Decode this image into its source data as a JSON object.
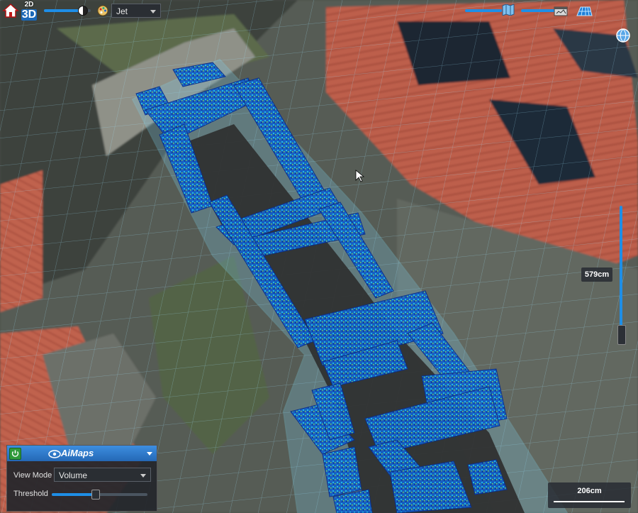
{
  "toolbar": {
    "mode_2d": "2D",
    "mode_3d": "3D",
    "palette": "Jet"
  },
  "viewport": {
    "height_readout": "579cm",
    "scale_label": "206cm"
  },
  "panel": {
    "brand": "AiMaps",
    "view_mode_label": "View Mode",
    "view_mode_value": "Volume",
    "threshold_label": "Threshold",
    "threshold_value": 0.45
  },
  "colors": {
    "accent": "#1e8ee6",
    "header": "#2f7fd0",
    "power": "#2e9a3a"
  },
  "icons": [
    "home-icon",
    "palette-icon",
    "map-layer-icon",
    "terrain-icon",
    "grid-icon",
    "globe-icon"
  ]
}
